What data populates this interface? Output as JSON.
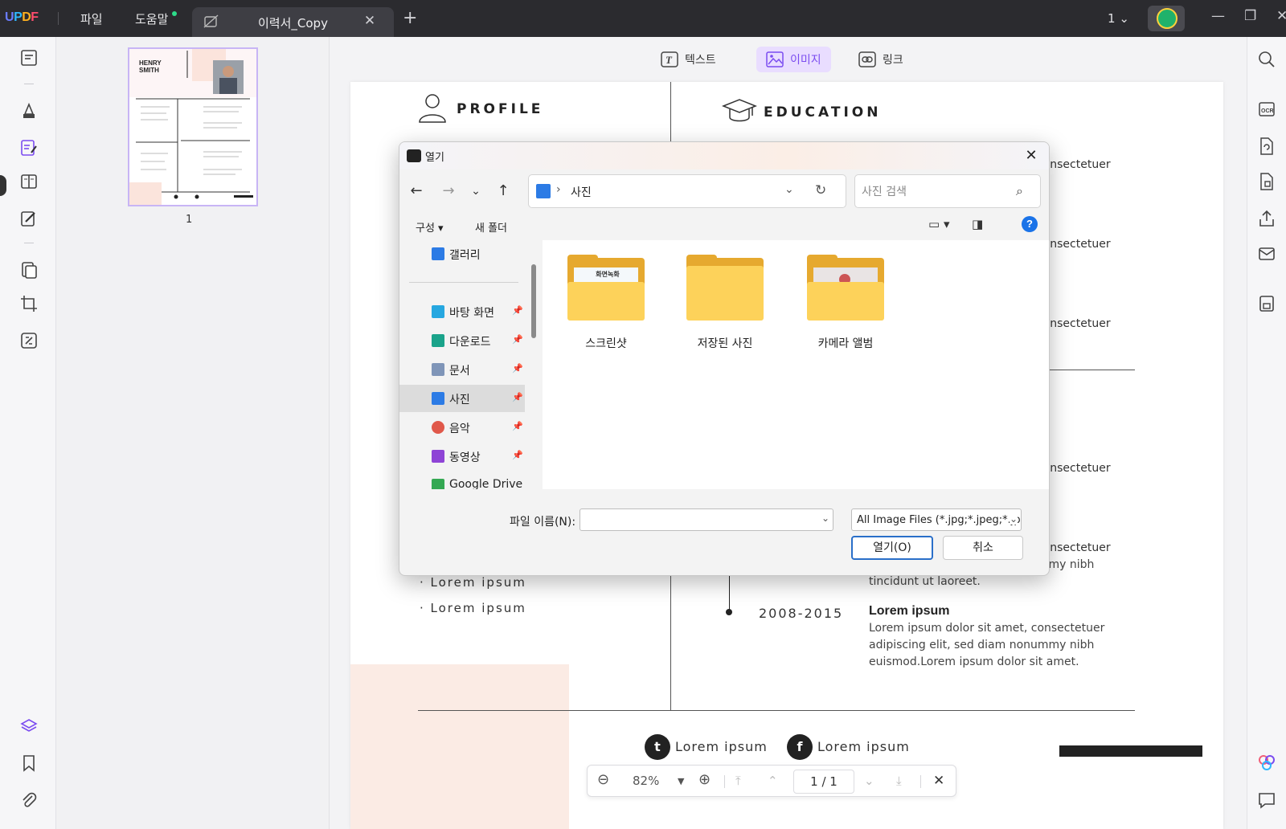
{
  "titlebar": {
    "logo": "UPDF",
    "menu_file": "파일",
    "menu_help": "도움말",
    "tab_title": "이력서_Copy",
    "tab_close": "✕",
    "tab_add": "+",
    "page_indicator": "1",
    "win_minimize": "—",
    "win_restore": "❐",
    "win_close": "✕"
  },
  "thumbnails": {
    "page_number": "1"
  },
  "editbar": {
    "text": "텍스트",
    "image": "이미지",
    "link": "링크"
  },
  "document": {
    "profile": "PROFILE",
    "education": "EDUCATION",
    "lorem_consectetuer": "consectetuer",
    "bullet": "· Lorem ipsum",
    "partial_line": "adipiscing elit, sed diam nonummy nibh",
    "partial_line2": "tincidunt ut laoreet.",
    "year": "2008-2015",
    "exp_title": "Lorem ipsum",
    "exp_body": "Lorem ipsum dolor sit amet, consectetuer adipiscing elit, sed diam nonummy nibh euismod.Lorem ipsum dolor sit amet.",
    "twitter_glyph": "t",
    "facebook_glyph": "f",
    "social_twitter": "Lorem ipsum",
    "social_facebook": "Lorem ipsum"
  },
  "zoombar": {
    "zoom": "82%",
    "page": "1 / 1",
    "zoom_out": "⊖",
    "zoom_in": "⊕",
    "close": "✕"
  },
  "dialog": {
    "title": "열기",
    "close": "✕",
    "breadcrumb_sep": "›",
    "path": "사진",
    "search_placeholder": "사진 검색",
    "organize": "구성 ▾",
    "new_folder": "새 폴더",
    "help": "?",
    "nav_items": [
      {
        "label": "갤러리",
        "color": "#2c7be5"
      },
      {
        "label": "바탕 화면",
        "color": "#26a7e0"
      },
      {
        "label": "다운로드",
        "color": "#1aa38a"
      },
      {
        "label": "문서",
        "color": "#7f95b8"
      },
      {
        "label": "사진",
        "color": "#2c7be5"
      },
      {
        "label": "음악",
        "color": "#e0584a"
      },
      {
        "label": "동영상",
        "color": "#8e44d6"
      },
      {
        "label": "Google Drive",
        "color": "#34a853"
      }
    ],
    "folders": [
      {
        "label": "스크린샷",
        "thumb_text": "화면녹화"
      },
      {
        "label": "저장된 사진"
      },
      {
        "label": "카메라 앨범"
      }
    ],
    "filename_label": "파일 이름(N):",
    "filename_value": "",
    "filter": "All Image Files (*.jpg;*.jpeg;*.jp",
    "open_button": "열기(O)",
    "cancel_button": "취소"
  },
  "colors": {
    "accent": "#7b4cf0",
    "titlebar": "#2b2b2f",
    "folder": "#fdd25a",
    "dialog_primary": "#2a6fc9"
  }
}
